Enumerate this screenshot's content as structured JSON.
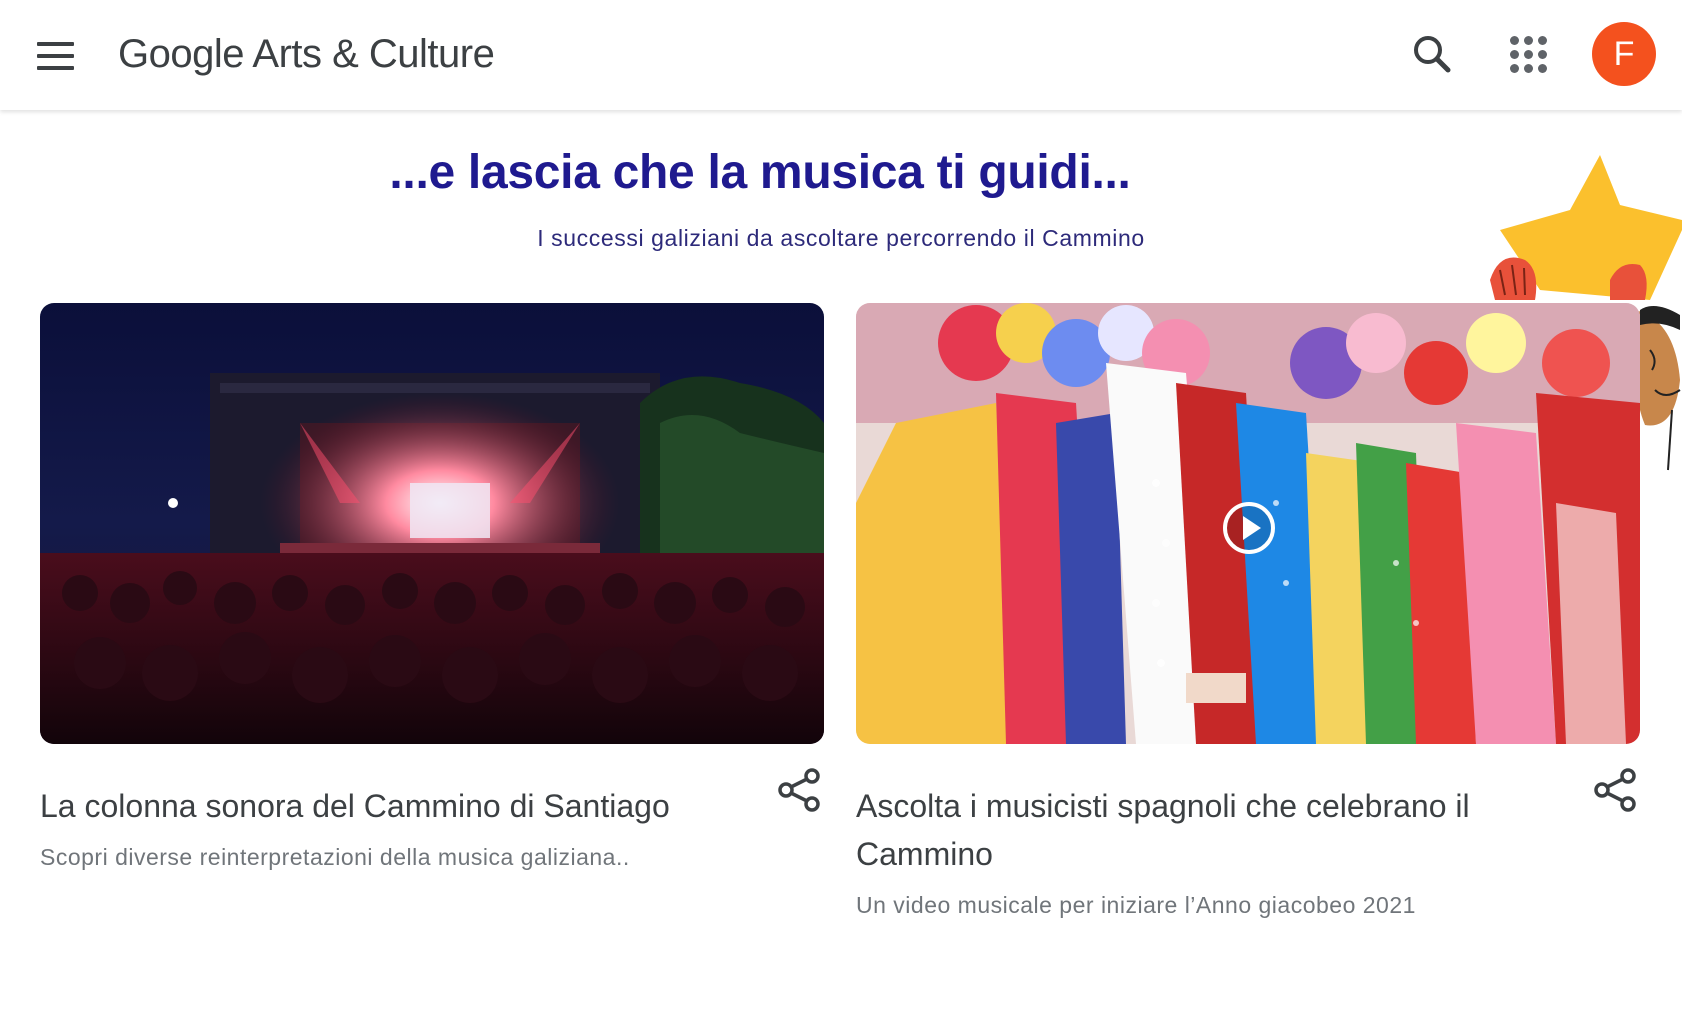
{
  "header": {
    "menu_icon": "hamburger-menu-icon",
    "logo_google": "Google",
    "logo_suffix": "Arts & Culture",
    "search_icon": "search-icon",
    "apps_icon": "apps-grid-icon",
    "avatar_letter": "F",
    "avatar_color": "#f4511e"
  },
  "section": {
    "title": "...e lascia che la musica ti guidi...",
    "subtitle": "I successi galiziani da ascoltare percorrendo il Cammino"
  },
  "cards": [
    {
      "title": "La colonna sonora del Cammino di Santiago",
      "description": "Scopri diverse reinterpretazioni della musica galiziana..",
      "image": "concert-stage-at-night",
      "share_icon": "share-icon"
    },
    {
      "title": "Ascolta i musicisti spagnoli che celebrano il Cammino",
      "description": "Un video musicale per iniziare l’Anno giacobeo 2021",
      "image": "traditional-dancers-with-ribbons-and-flowers",
      "play_icon": "play-icon",
      "share_icon": "share-icon"
    }
  ],
  "colors": {
    "title": "#1f1a8f",
    "subtitle": "#2d2a7a",
    "text": "#3c4043",
    "muted": "#70757a"
  }
}
